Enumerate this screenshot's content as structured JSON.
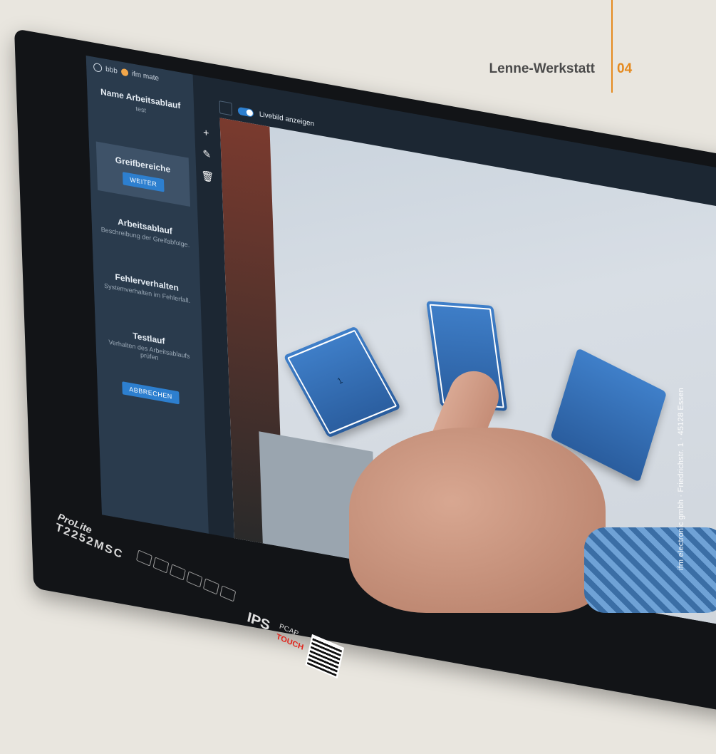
{
  "header": {
    "title": "Lenne-Werkstatt",
    "page_number": "04"
  },
  "credit": "ifm electronic gmbh · Friedrichstr. 1 · 45128 Essen",
  "app": {
    "user_primary": "bbb",
    "user_secondary": "ifm mate",
    "steps": [
      {
        "title": "Name Arbeitsablauf",
        "subtitle": "test"
      },
      {
        "title": "Greifbereiche",
        "button": "WEITER"
      },
      {
        "title": "Arbeitsablauf",
        "subtitle": "Beschreibung der Greifabfolge."
      },
      {
        "title": "Fehlerverhalten",
        "subtitle": "Systemverhalten im Fehlerfall."
      },
      {
        "title": "Testlauf",
        "subtitle": "Verhalten des Arbeitsablaufs prüfen"
      }
    ],
    "cancel_button": "ABBRECHEN",
    "toolbar": {
      "toggle_label": "Livebild anzeigen",
      "toggle_on": true
    },
    "tools": [
      "plus-icon",
      "pencil-icon",
      "trash-icon"
    ],
    "box_label": "1"
  },
  "bezel": {
    "brand": "ProLite",
    "model": "T2252MSC",
    "ips": "IPS",
    "pcap": "PCAP",
    "touch": "TOUCH"
  },
  "colors": {
    "accent": "#e58a1f",
    "ui_blue": "#2d7fcf",
    "sidebar": "#2a3b4d"
  }
}
